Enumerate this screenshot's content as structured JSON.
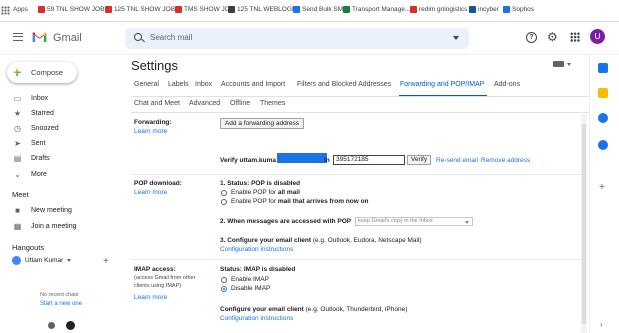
{
  "bookmarks": {
    "items": [
      {
        "label": "Apps",
        "color": "none"
      },
      {
        "label": "59 TNL SHOW JOB",
        "color": "#d93025"
      },
      {
        "label": "125 TNL SHOW JOB",
        "color": "#d93025"
      },
      {
        "label": "TMS SHOW JOB",
        "color": "#d93025"
      },
      {
        "label": "125 TNL WEBLOGIC",
        "color": "#3c4043"
      },
      {
        "label": "Send Bulk SMS",
        "color": "#1a73e8"
      },
      {
        "label": "Transport Manage...",
        "color": "#188038"
      },
      {
        "label": "redim gnlogistics",
        "color": "#d93025"
      },
      {
        "label": "incyber",
        "color": "#174ea6"
      },
      {
        "label": "Sophos",
        "color": "#1a73e8"
      }
    ]
  },
  "header": {
    "app_name": "Gmail",
    "search_placeholder": "Search mail",
    "avatar_initial": "U",
    "help_glyph": "?",
    "gear_glyph": "⚙"
  },
  "nav": {
    "compose_label": "Compose",
    "items": [
      {
        "label": "Inbox",
        "icon": "inbox-icon",
        "glyph": "▭"
      },
      {
        "label": "Starred",
        "icon": "star-icon",
        "glyph": "★"
      },
      {
        "label": "Snoozed",
        "icon": "clock-icon",
        "glyph": "◷"
      },
      {
        "label": "Sent",
        "icon": "send-icon",
        "glyph": "➤"
      },
      {
        "label": "Drafts",
        "icon": "draft-icon",
        "glyph": "▤"
      },
      {
        "label": "More",
        "icon": "chevron-down-icon",
        "glyph": "⌄"
      }
    ],
    "meet_title": "Meet",
    "meet_items": [
      {
        "label": "New meeting",
        "icon": "video-icon",
        "glyph": "■"
      },
      {
        "label": "Join a meeting",
        "icon": "keyboard-icon",
        "glyph": "▦"
      }
    ],
    "hangouts_title": "Hangouts",
    "hangouts_user": "Uttam Kumar",
    "hangouts_plus": "+",
    "no_recent": "No recent chats",
    "start_new": "Start a new one"
  },
  "settings": {
    "title": "Settings",
    "tabs_row1": [
      "General",
      "Labels",
      "Inbox",
      "Accounts and Import",
      "Filters and Blocked Addresses",
      "Forwarding and POP/IMAP",
      "Add-ons"
    ],
    "tabs_row2": [
      "Chat and Meet",
      "Advanced",
      "Offline",
      "Themes"
    ],
    "active_tab": "Forwarding and POP/IMAP",
    "forwarding": {
      "label": "Forwarding:",
      "learn_more": "Learn more",
      "add_button": "Add a forwarding address",
      "verify_prefix": "Verify uttam.kuma",
      "verify_suffix": "in",
      "code_value": "395172185",
      "verify_button": "Verify",
      "resend": "Re-send email",
      "remove": "Remove address"
    },
    "pop": {
      "label": "POP download:",
      "learn_more": "Learn more",
      "status_prefix": "1. Status: ",
      "status": "POP is disabled",
      "opt_all_prefix": "Enable POP for ",
      "opt_all_bold": "all mail",
      "opt_now_prefix": "Enable POP for ",
      "opt_now_bold": "mail that arrives from now on",
      "step2_prefix": "2. When messages are accessed with POP",
      "step2_select": "keep Gmail's copy in the Inbox",
      "step3_prefix": "3. Configure your email client",
      "step3_rest": " (e.g. Outlook, Eudora, Netscape Mail)",
      "instructions": "Configuration instructions"
    },
    "imap": {
      "label": "IMAP access:",
      "sub": "(access Gmail from other clients using IMAP)",
      "learn_more": "Learn more",
      "status_prefix": "Status: ",
      "status": "IMAP is disabled",
      "enable": "Enable IMAP",
      "disable": "Disable IMAP",
      "configure_prefix": "Configure your email client",
      "configure_rest": " (e.g. Outlook, Thunderbird, iPhone)",
      "instructions": "Configuration instructions"
    }
  },
  "colors": {
    "accent": "#0b57d0",
    "link": "#1a73e8",
    "avatar": "#7b1fa2"
  }
}
